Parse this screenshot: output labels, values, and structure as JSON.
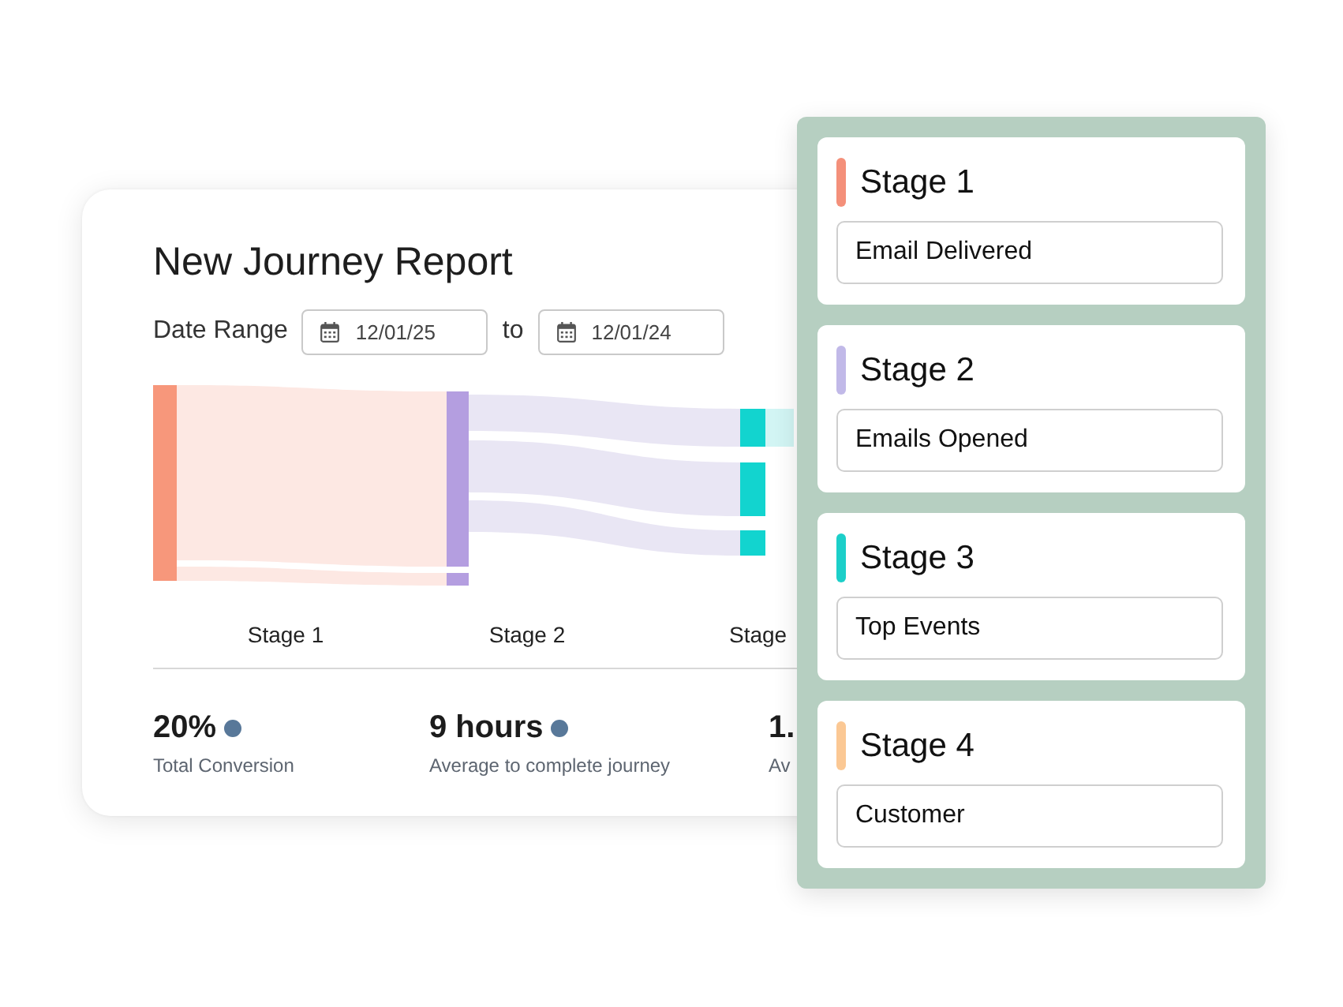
{
  "report": {
    "title": "New Journey Report",
    "date_range": {
      "label": "Date Range",
      "from": "12/01/25",
      "separator": "to",
      "to": "12/01/24"
    },
    "stage_labels": [
      "Stage 1",
      "Stage 2",
      "Stage"
    ],
    "stats": [
      {
        "value": "20%",
        "label": "Total Conversion",
        "dot": true
      },
      {
        "value": "9 hours",
        "label": "Average to complete journey",
        "dot": true
      },
      {
        "value": "1.",
        "label": "Av",
        "dot": false
      }
    ]
  },
  "stages": [
    {
      "title": "Stage 1",
      "color": "#f4907a",
      "value": "Email Delivered"
    },
    {
      "title": "Stage 2",
      "color": "#c1b9e8",
      "value": "Emails Opened"
    },
    {
      "title": "Stage 3",
      "color": "#1ccfc9",
      "value": "Top Events"
    },
    {
      "title": "Stage 4",
      "color": "#fbc894",
      "value": "Customer"
    }
  ]
}
